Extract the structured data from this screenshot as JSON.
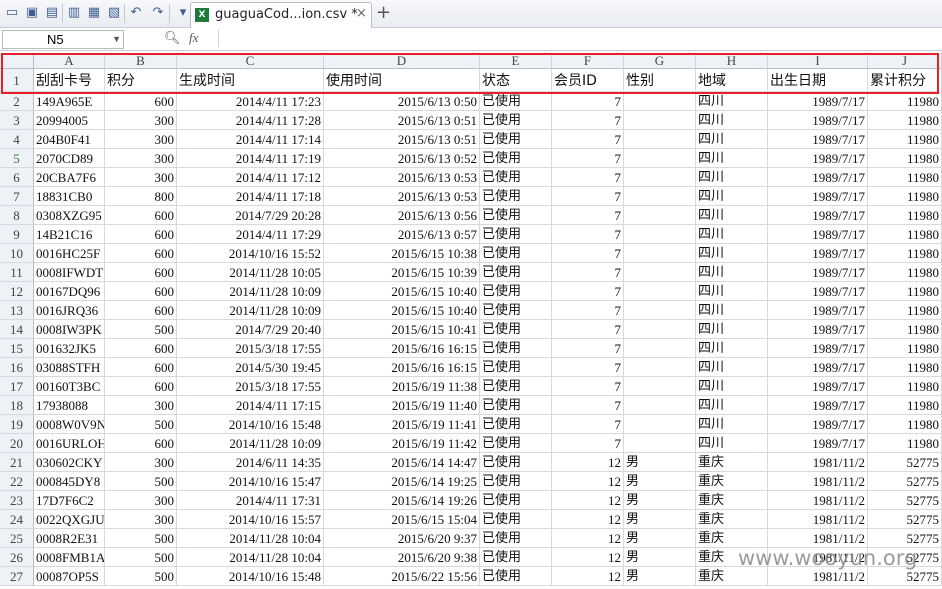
{
  "toolbar": {
    "icons": [
      "folder-icon",
      "save-icon",
      "pdf-icon",
      "print-icon",
      "print-preview-icon",
      "preview-icon",
      "undo-icon",
      "redo-icon",
      "customize-icon"
    ],
    "tab_title": "guaguaCod...ion.csv *",
    "tab_close": "×",
    "new_tab": "+"
  },
  "formula_bar": {
    "cell_ref": "N5",
    "fx_label": "fx",
    "value": ""
  },
  "columns": [
    "A",
    "B",
    "C",
    "D",
    "E",
    "F",
    "G",
    "H",
    "I",
    "J"
  ],
  "header_row": {
    "row_num": "1",
    "cells": [
      "刮刮卡号",
      "积分",
      "生成时间",
      "使用时间",
      "状态",
      "会员ID",
      "性别",
      "地域",
      "出生日期",
      "累计积分"
    ]
  },
  "rows": [
    {
      "n": "2",
      "cells": [
        "149A965E",
        "600",
        "2014/4/11 17:23",
        "2015/6/13 0:50",
        "已使用",
        "7",
        "",
        "四川",
        "1989/7/17",
        "11980"
      ]
    },
    {
      "n": "3",
      "cells": [
        "20994005",
        "300",
        "2014/4/11 17:28",
        "2015/6/13 0:51",
        "已使用",
        "7",
        "",
        "四川",
        "1989/7/17",
        "11980"
      ]
    },
    {
      "n": "4",
      "cells": [
        "204B0F41",
        "300",
        "2014/4/11 17:14",
        "2015/6/13 0:51",
        "已使用",
        "7",
        "",
        "四川",
        "1989/7/17",
        "11980"
      ]
    },
    {
      "n": "5",
      "cells": [
        "2070CD89",
        "300",
        "2014/4/11 17:19",
        "2015/6/13 0:52",
        "已使用",
        "7",
        "",
        "四川",
        "1989/7/17",
        "11980"
      ]
    },
    {
      "n": "6",
      "cells": [
        "20CBA7F6",
        "300",
        "2014/4/11 17:12",
        "2015/6/13 0:53",
        "已使用",
        "7",
        "",
        "四川",
        "1989/7/17",
        "11980"
      ]
    },
    {
      "n": "7",
      "cells": [
        "18831CB0",
        "800",
        "2014/4/11 17:18",
        "2015/6/13 0:53",
        "已使用",
        "7",
        "",
        "四川",
        "1989/7/17",
        "11980"
      ]
    },
    {
      "n": "8",
      "cells": [
        "0308XZG95",
        "600",
        "2014/7/29 20:28",
        "2015/6/13 0:56",
        "已使用",
        "7",
        "",
        "四川",
        "1989/7/17",
        "11980"
      ]
    },
    {
      "n": "9",
      "cells": [
        "14B21C16",
        "600",
        "2014/4/11 17:29",
        "2015/6/13 0:57",
        "已使用",
        "7",
        "",
        "四川",
        "1989/7/17",
        "11980"
      ]
    },
    {
      "n": "10",
      "cells": [
        "0016HC25F",
        "600",
        "2014/10/16 15:52",
        "2015/6/15 10:38",
        "已使用",
        "7",
        "",
        "四川",
        "1989/7/17",
        "11980"
      ]
    },
    {
      "n": "11",
      "cells": [
        "0008IFWDT",
        "600",
        "2014/11/28 10:05",
        "2015/6/15 10:39",
        "已使用",
        "7",
        "",
        "四川",
        "1989/7/17",
        "11980"
      ]
    },
    {
      "n": "12",
      "cells": [
        "00167DQ96",
        "600",
        "2014/11/28 10:09",
        "2015/6/15 10:40",
        "已使用",
        "7",
        "",
        "四川",
        "1989/7/17",
        "11980"
      ]
    },
    {
      "n": "13",
      "cells": [
        "0016JRQ36",
        "600",
        "2014/11/28 10:09",
        "2015/6/15 10:40",
        "已使用",
        "7",
        "",
        "四川",
        "1989/7/17",
        "11980"
      ]
    },
    {
      "n": "14",
      "cells": [
        "0008IW3PK",
        "500",
        "2014/7/29 20:40",
        "2015/6/15 10:41",
        "已使用",
        "7",
        "",
        "四川",
        "1989/7/17",
        "11980"
      ]
    },
    {
      "n": "15",
      "cells": [
        "001632JK5",
        "600",
        "2015/3/18 17:55",
        "2015/6/16 16:15",
        "已使用",
        "7",
        "",
        "四川",
        "1989/7/17",
        "11980"
      ]
    },
    {
      "n": "16",
      "cells": [
        "03088STFH",
        "600",
        "2014/5/30 19:45",
        "2015/6/16 16:15",
        "已使用",
        "7",
        "",
        "四川",
        "1989/7/17",
        "11980"
      ]
    },
    {
      "n": "17",
      "cells": [
        "00160T3BC",
        "600",
        "2015/3/18 17:55",
        "2015/6/19 11:38",
        "已使用",
        "7",
        "",
        "四川",
        "1989/7/17",
        "11980"
      ]
    },
    {
      "n": "18",
      "cells": [
        "17938088",
        "300",
        "2014/4/11 17:15",
        "2015/6/19 11:40",
        "已使用",
        "7",
        "",
        "四川",
        "1989/7/17",
        "11980"
      ]
    },
    {
      "n": "19",
      "cells": [
        "0008W0V9N",
        "500",
        "2014/10/16 15:48",
        "2015/6/19 11:41",
        "已使用",
        "7",
        "",
        "四川",
        "1989/7/17",
        "11980"
      ]
    },
    {
      "n": "20",
      "cells": [
        "0016URLOH",
        "600",
        "2014/11/28 10:09",
        "2015/6/19 11:42",
        "已使用",
        "7",
        "",
        "四川",
        "1989/7/17",
        "11980"
      ]
    },
    {
      "n": "21",
      "cells": [
        "030602CKY",
        "300",
        "2014/6/11 14:35",
        "2015/6/14 14:47",
        "已使用",
        "12",
        "男",
        "重庆",
        "1981/11/2",
        "52775"
      ]
    },
    {
      "n": "22",
      "cells": [
        "000845DY8",
        "500",
        "2014/10/16 15:47",
        "2015/6/14 19:25",
        "已使用",
        "12",
        "男",
        "重庆",
        "1981/11/2",
        "52775"
      ]
    },
    {
      "n": "23",
      "cells": [
        "17D7F6C2",
        "300",
        "2014/4/11 17:31",
        "2015/6/14 19:26",
        "已使用",
        "12",
        "男",
        "重庆",
        "1981/11/2",
        "52775"
      ]
    },
    {
      "n": "24",
      "cells": [
        "0022QXGJU",
        "300",
        "2014/10/16 15:57",
        "2015/6/15 15:04",
        "已使用",
        "12",
        "男",
        "重庆",
        "1981/11/2",
        "52775"
      ]
    },
    {
      "n": "25",
      "cells": [
        "0008R2E31",
        "500",
        "2014/11/28 10:04",
        "2015/6/20 9:37",
        "已使用",
        "12",
        "男",
        "重庆",
        "1981/11/2",
        "52775"
      ]
    },
    {
      "n": "26",
      "cells": [
        "0008FMB1A",
        "500",
        "2014/11/28 10:04",
        "2015/6/20 9:38",
        "已使用",
        "12",
        "男",
        "重庆",
        "1981/11/2",
        "52775"
      ]
    },
    {
      "n": "27",
      "cells": [
        "00087OP5S",
        "500",
        "2014/10/16 15:48",
        "2015/6/22 15:56",
        "已使用",
        "12",
        "男",
        "重庆",
        "1981/11/2",
        "52775"
      ]
    }
  ],
  "selected_row": "5",
  "highlight_color": "#e8202a",
  "watermark": "www.wooyun.org"
}
